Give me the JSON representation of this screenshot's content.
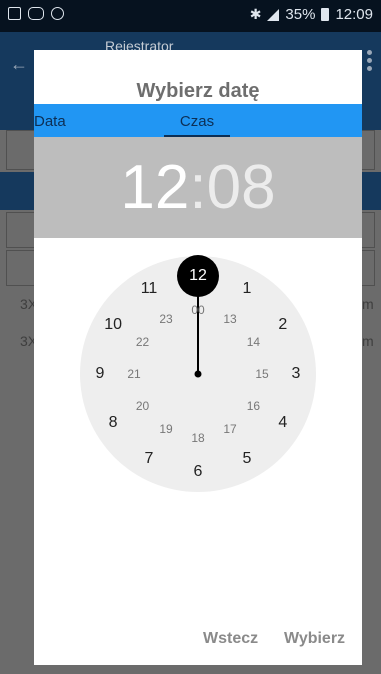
{
  "status_bar": {
    "left_icons": [
      "image-icon",
      "voicemail-icon",
      "sync-icon"
    ],
    "battery_text": "35%",
    "time": "12:09"
  },
  "background": {
    "app_title": "Rejestrator",
    "row_labels": [
      "3X",
      "3X"
    ],
    "row_suffix": [
      "m",
      "m"
    ]
  },
  "dialog": {
    "title": "Wybierz datę",
    "tabs": [
      {
        "label": "Data",
        "active": false
      },
      {
        "label": "Czas",
        "active": true
      }
    ],
    "selected_time": {
      "hour": "12",
      "separator": ":",
      "minute": "08"
    },
    "clock": {
      "selected_value": 12,
      "outer": [
        "12",
        "1",
        "2",
        "3",
        "4",
        "5",
        "6",
        "7",
        "8",
        "9",
        "10",
        "11"
      ],
      "inner": [
        "00",
        "13",
        "14",
        "15",
        "16",
        "17",
        "18",
        "19",
        "20",
        "21",
        "22",
        "23"
      ]
    },
    "buttons": {
      "back": "Wstecz",
      "ok": "Wybierz"
    }
  },
  "colors": {
    "tab_bar": "#2196f3",
    "time_header": "#bdbdbd",
    "clock_face": "#eeeeee",
    "hand": "#000000",
    "app_bar_dimmed": "#15395d"
  }
}
